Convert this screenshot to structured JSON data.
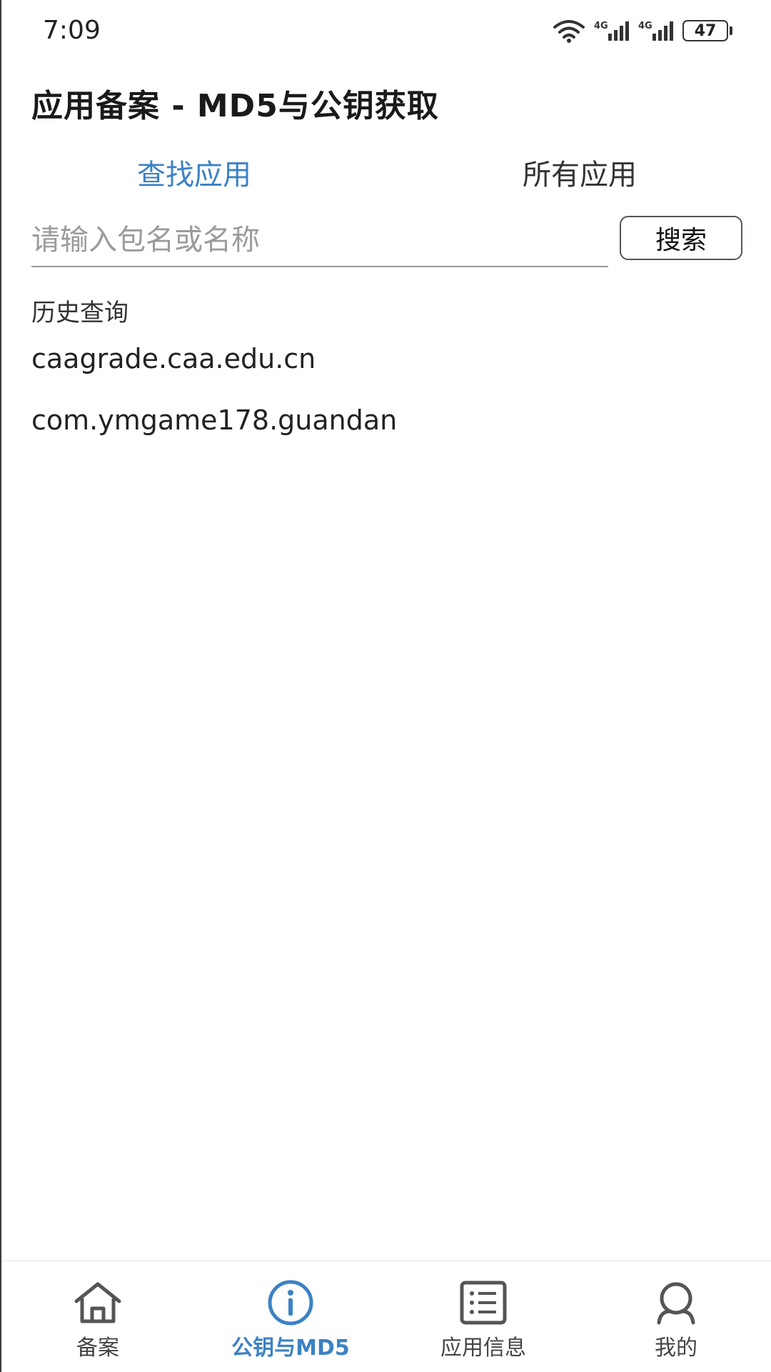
{
  "status_bar": {
    "time": "7:09",
    "network_1": "4G",
    "network_2": "4G",
    "battery_level": "47"
  },
  "app_title": "应用备案 - MD5与公钥获取",
  "tabs": [
    {
      "label": "查找应用",
      "active": true
    },
    {
      "label": "所有应用",
      "active": false
    }
  ],
  "search": {
    "placeholder": "请输入包名或名称",
    "value": "",
    "button_label": "搜索"
  },
  "history": {
    "label": "历史查询",
    "items": [
      "caagrade.caa.edu.cn",
      "com.ymgame178.guandan"
    ]
  },
  "bottom_nav": [
    {
      "label": "备案",
      "icon": "home-icon",
      "active": false
    },
    {
      "label": "公钥与MD5",
      "icon": "info-icon",
      "active": true
    },
    {
      "label": "应用信息",
      "icon": "list-icon",
      "active": false
    },
    {
      "label": "我的",
      "icon": "profile-icon",
      "active": false
    }
  ],
  "colors": {
    "accent": "#3b82c4",
    "text": "#1a1a1a",
    "inactive_icon": "#555555"
  }
}
